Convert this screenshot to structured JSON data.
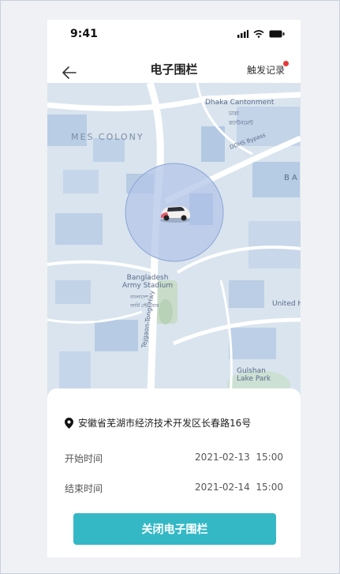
{
  "status": {
    "time": "9:41"
  },
  "nav": {
    "title": "电子围栏",
    "record_label": "触发记录"
  },
  "map": {
    "labels": {
      "dhaka": "Dhaka Cantonment",
      "dhaka_bn": "ঢাকা\nক্যান্টনমেন্ট",
      "mes": "MES COLONY",
      "dohs": "DOHS Bypass",
      "ba": "B A",
      "stadium": "Bangladesh\nArmy Stadium",
      "stadium_bn": "বাংলাদেশ\nআর্মি স্টেডিয়াম",
      "united": "United Ho",
      "hwy": "Tejgaon-Tongi Hwy",
      "gulshan": "Gulshan\nLake Park"
    }
  },
  "sheet": {
    "address": "安徽省芜湖市经济技术开发区长春路16号",
    "start_label": "开始时间",
    "start_value": "2021-02-13  15:00",
    "end_label": "结束时间",
    "end_value": "2021-02-14  15:00",
    "close_button": "关闭电子围栏"
  },
  "colors": {
    "accent": "#35b8c6",
    "fence": "#b4c6e8",
    "dot": "#e43a3a"
  }
}
